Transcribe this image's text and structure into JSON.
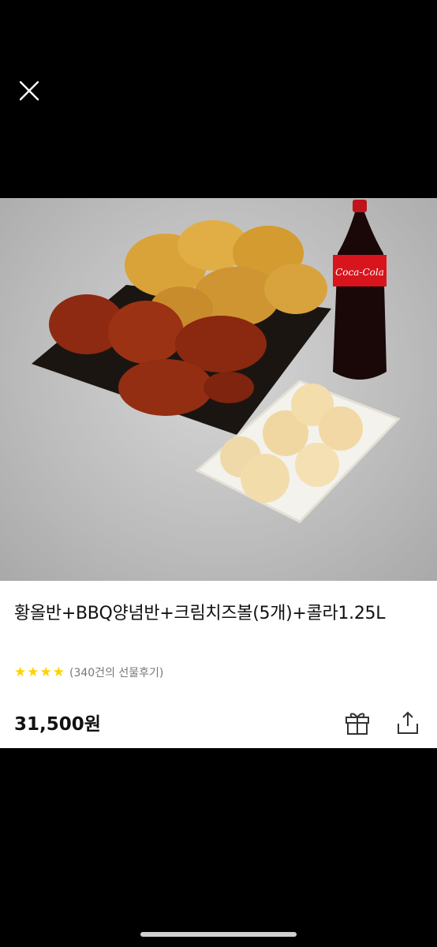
{
  "header": {
    "close_icon": "close-icon"
  },
  "product": {
    "title": "황올반+BBQ양념반+크림치즈볼(5개)+콜라1.25L",
    "rating_stars": 4,
    "reviews_text": "(340건의 선물후기)",
    "price": "31,500원",
    "image_bottle_text": "Coca-Cola"
  },
  "actions": {
    "gift_icon": "gift-icon",
    "share_icon": "share-icon"
  },
  "colors": {
    "star": "#ffd200",
    "background": "#000000",
    "card": "#ffffff"
  }
}
